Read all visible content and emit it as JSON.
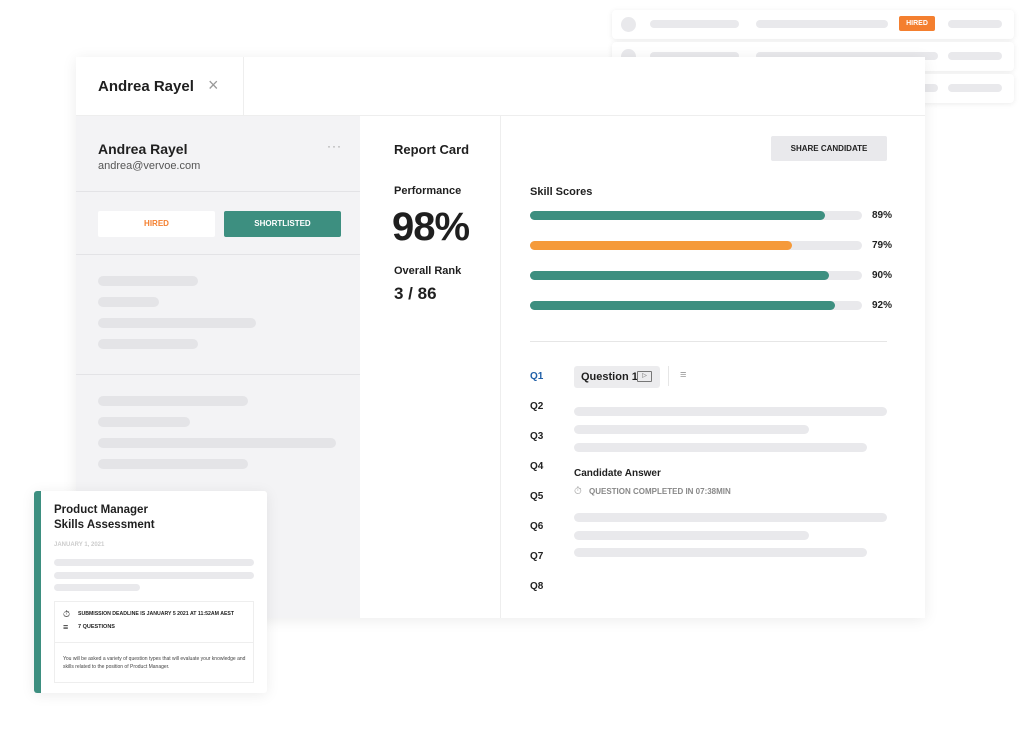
{
  "top_list": {
    "badge": "HIRED",
    "badge_color": "#f47f2f"
  },
  "candidate": {
    "tab_name": "Andrea Rayel",
    "name": "Andrea Rayel",
    "email": "andrea@vervoe.com",
    "hired_label": "HIRED",
    "shortlisted_label": "SHORTLISTED"
  },
  "report": {
    "title": "Report Card",
    "performance_label": "Performance",
    "performance": "98%",
    "rank_label": "Overall Rank",
    "rank": "3 / 86"
  },
  "share_button": "SHARE CANDIDATE",
  "skills": {
    "title": "Skill Scores",
    "items": [
      {
        "value": 89,
        "label": "89%",
        "color": "#3d8f80"
      },
      {
        "value": 79,
        "label": "79%",
        "color": "#f59a3a"
      },
      {
        "value": 90,
        "label": "90%",
        "color": "#3d8f80"
      },
      {
        "value": 92,
        "label": "92%",
        "color": "#3d8f80"
      }
    ]
  },
  "questions": {
    "nav": [
      "Q1",
      "Q2",
      "Q3",
      "Q4",
      "Q5",
      "Q6",
      "Q7",
      "Q8"
    ],
    "active": "Q1",
    "chip": "Question 1",
    "answer_title": "Candidate Answer",
    "completed": "QUESTION COMPLETED IN 07:38MIN"
  },
  "assessment": {
    "title_line1": "Product Manager",
    "title_line2": "Skills Assessment",
    "date": "JANUARY 1, 2021",
    "deadline": "SUBMISSION DEADLINE IS JANUARY 5 2021 AT 11:52AM AEST",
    "questions": "7 QUESTIONS",
    "description": "You will be asked a variety of question types that will evaluate your knowledge and skills related to the position of Product Manager."
  }
}
